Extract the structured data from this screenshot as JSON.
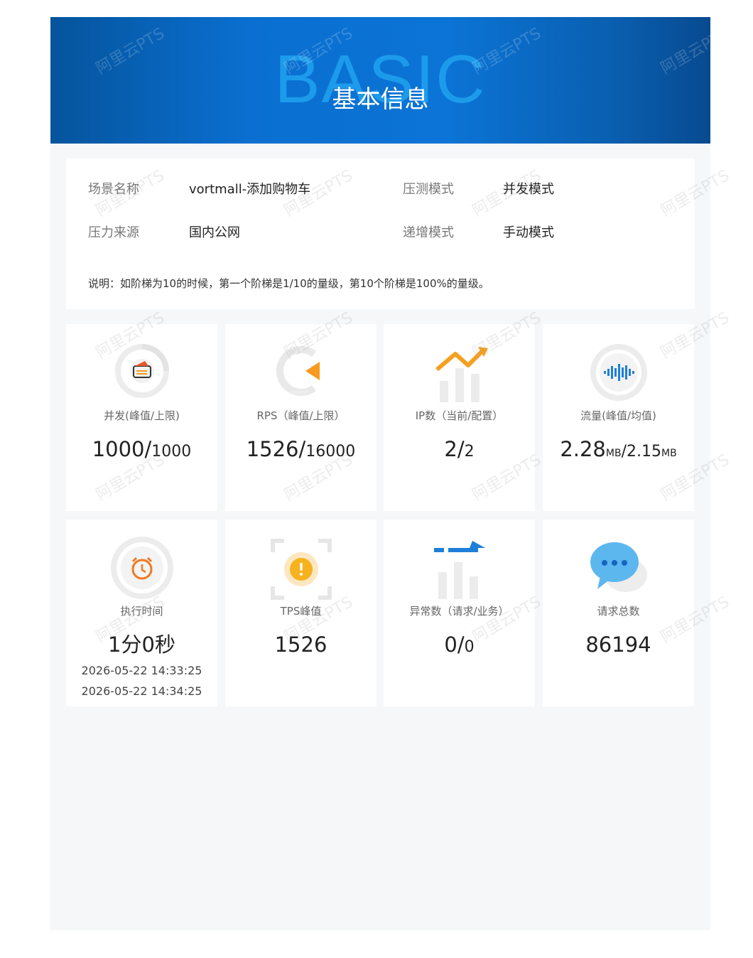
{
  "header": {
    "bg_word": "BASIC",
    "title": "基本信息"
  },
  "info": {
    "scene_name_label": "场景名称",
    "scene_name_value": "vortmall-添加购物车",
    "mode_label": "压测模式",
    "mode_value": "并发模式",
    "source_label": "压力来源",
    "source_value": "国内公网",
    "increment_label": "递增模式",
    "increment_value": "手动模式",
    "note": "说明：如阶梯为10的时候，第一个阶梯是1/10的量级，第10个阶梯是100%的量级。"
  },
  "cards": {
    "concurrency": {
      "label": "并发(峰值/上限)",
      "value_main": "1000/",
      "value_small": "1000"
    },
    "rps": {
      "label": "RPS（峰值/上限）",
      "value_main": "1526/",
      "value_small": "16000"
    },
    "ip": {
      "label": "IP数（当前/配置）",
      "value_main": "2/",
      "value_small": "2"
    },
    "traffic": {
      "label": "流量(峰值/均值)",
      "value_main1": "2.28",
      "unit1": "MB",
      "value_main2": "/2.15",
      "unit2": "MB"
    },
    "duration": {
      "label": "执行时间",
      "value": "1分0秒",
      "start_time": "2026-05-22 14:33:25",
      "end_time": "2026-05-22 14:34:25"
    },
    "tps": {
      "label": "TPS峰值",
      "value": "1526"
    },
    "errors": {
      "label": "异常数（请求/业务）",
      "value_main": "0/",
      "value_small": "0"
    },
    "requests": {
      "label": "请求总数",
      "value": "86194"
    }
  },
  "watermark": {
    "text": "阿里云PTS"
  },
  "colors": {
    "header_blue": "#0b74d6",
    "accent_orange": "#f79a1e",
    "accent_blue": "#1e7fd8"
  },
  "icons": [
    "wallet-icon",
    "rps-gauge-icon",
    "ip-bars-icon",
    "waveform-icon",
    "alarm-clock-icon",
    "warning-scan-icon",
    "error-bars-icon",
    "chat-bubble-icon"
  ]
}
